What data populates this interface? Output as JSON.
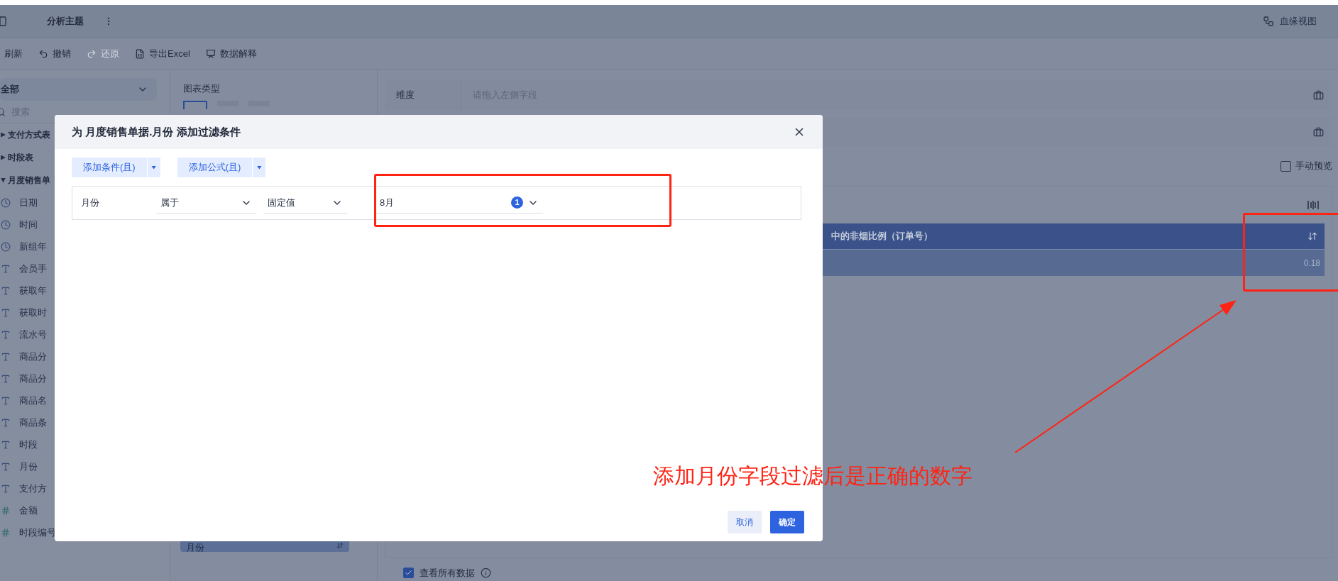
{
  "header": {
    "title": "分析主题",
    "lineage_label": "血缘视图"
  },
  "toolbar": [
    {
      "label": "刷新",
      "disabled": false
    },
    {
      "label": "撤销",
      "disabled": false
    },
    {
      "label": "还原",
      "disabled": true
    },
    {
      "label": "导出Excel",
      "disabled": false
    },
    {
      "label": "数据解释",
      "disabled": false
    }
  ],
  "sidebar": {
    "dropdown": "全部",
    "search_placeholder": "搜索",
    "tables": [
      {
        "label": "支付方式表",
        "expanded": false
      },
      {
        "label": "时段表",
        "expanded": false
      },
      {
        "label": "月度销售单",
        "expanded": true,
        "children": [
          {
            "label": "日期",
            "kind": "date"
          },
          {
            "label": "时间",
            "kind": "date"
          },
          {
            "label": "新组年",
            "kind": "date"
          },
          {
            "label": "会员手",
            "kind": "text"
          },
          {
            "label": "获取年",
            "kind": "text"
          },
          {
            "label": "获取时",
            "kind": "text"
          },
          {
            "label": "流水号",
            "kind": "text"
          },
          {
            "label": "商品分",
            "kind": "text"
          },
          {
            "label": "商品分",
            "kind": "text"
          },
          {
            "label": "商品名",
            "kind": "text"
          },
          {
            "label": "商品条",
            "kind": "text"
          },
          {
            "label": "时段",
            "kind": "text"
          },
          {
            "label": "月份",
            "kind": "text"
          },
          {
            "label": "支付方",
            "kind": "text"
          },
          {
            "label": "金额",
            "kind": "number"
          },
          {
            "label": "时段编号",
            "kind": "number"
          }
        ]
      }
    ]
  },
  "chart_panel": {
    "title": "图表类型",
    "chart_types": [
      {
        "selected": true
      },
      {
        "selected": false
      },
      {
        "selected": false
      }
    ],
    "field_pill": "月份"
  },
  "dimension": {
    "label": "维度",
    "placeholder": "请拖入左侧字段"
  },
  "manual_preview": {
    "label": "手动预览",
    "checked": false
  },
  "table": {
    "header": "中的非烟比例（订单号）",
    "value": "0.18"
  },
  "view_all": {
    "label": "查看所有数据",
    "checked": true
  },
  "dialog": {
    "title": "为 月度销售单据.月份 添加过滤条件",
    "add_buttons": [
      "添加条件(且)",
      "添加公式(且)"
    ],
    "condition": {
      "field": "月份",
      "operator": "属于",
      "value_type": "固定值",
      "value": "8月",
      "count": "1"
    },
    "cancel": "取消",
    "ok": "确定"
  },
  "annotation": {
    "text": "添加月份字段过滤后是正确的数字"
  }
}
